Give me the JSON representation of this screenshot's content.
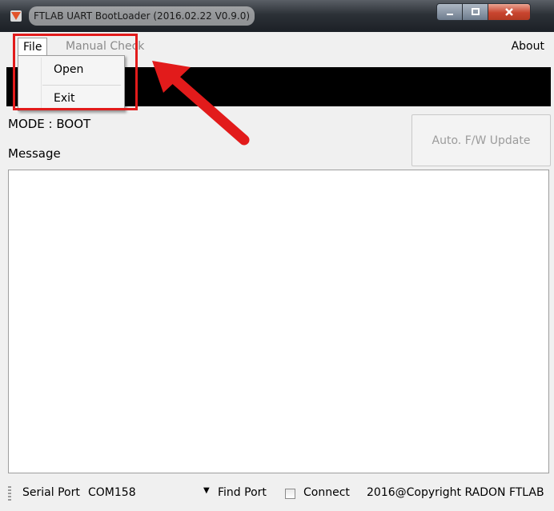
{
  "window": {
    "title": "FTLAB UART BootLoader (2016.02.22 V0.9.0)"
  },
  "menu": {
    "file": "File",
    "manual_check": "Manual Check",
    "about": "About",
    "dropdown": [
      "Open",
      "Exit"
    ]
  },
  "main": {
    "mode": "MODE : BOOT",
    "message_label": "Message",
    "update_button": "Auto. F/W Update"
  },
  "statusbar": {
    "serial_port_label": "Serial Port",
    "port_value": "COM158",
    "dropdown_arrow": "▼",
    "find_port": "Find Port",
    "connect": "Connect",
    "connect_checked": false,
    "copyright": "2016@Copyright RADON FTLAB"
  },
  "colors": {
    "annotation": "#e21b1b",
    "titlebar": "#2c3137"
  }
}
